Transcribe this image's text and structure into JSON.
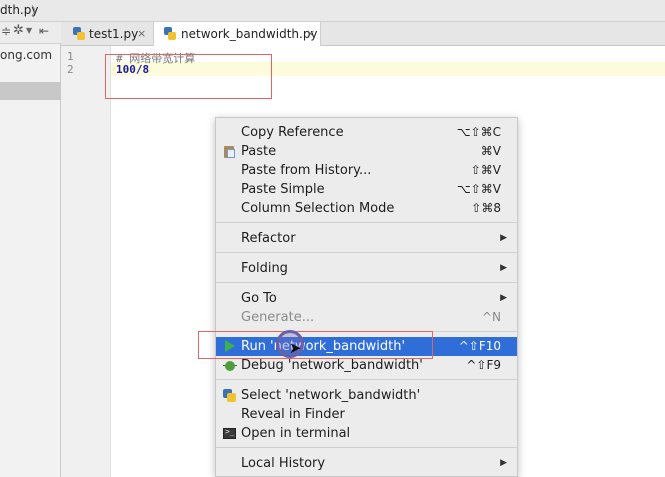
{
  "breadcrumb": {
    "file": "dth.py",
    "chevron": "〉"
  },
  "project_panel": {
    "domain_text": "ong.com"
  },
  "tabs": [
    {
      "label": "test1.py",
      "close": "×"
    },
    {
      "label": "network_bandwidth.py",
      "close": "×"
    }
  ],
  "editor": {
    "line_numbers": [
      "1",
      "2"
    ],
    "lines": [
      "# 网络带宽计算",
      "100/8"
    ]
  },
  "context_menu": {
    "copy_reference": {
      "label": "Copy Reference",
      "shortcut": "⌥⇧⌘C"
    },
    "paste": {
      "label": "Paste",
      "shortcut": "⌘V"
    },
    "paste_history": {
      "label": "Paste from History...",
      "shortcut": "⇧⌘V"
    },
    "paste_simple": {
      "label": "Paste Simple",
      "shortcut": "⌥⇧⌘V"
    },
    "column_selection": {
      "label": "Column Selection Mode",
      "shortcut": "⇧⌘8"
    },
    "refactor": {
      "label": "Refactor"
    },
    "folding": {
      "label": "Folding"
    },
    "goto": {
      "label": "Go To"
    },
    "generate": {
      "label": "Generate...",
      "shortcut": "^N"
    },
    "run": {
      "label": "Run 'network_bandwidth'",
      "shortcut": "^⇧F10"
    },
    "debug": {
      "label": "Debug 'network_bandwidth'",
      "shortcut": "^⇧F9"
    },
    "select": {
      "label": "Select 'network_bandwidth'"
    },
    "reveal": {
      "label": "Reveal in Finder"
    },
    "terminal": {
      "label": "Open in terminal"
    },
    "local_history": {
      "label": "Local History"
    },
    "submenu_arrow": "▶"
  }
}
